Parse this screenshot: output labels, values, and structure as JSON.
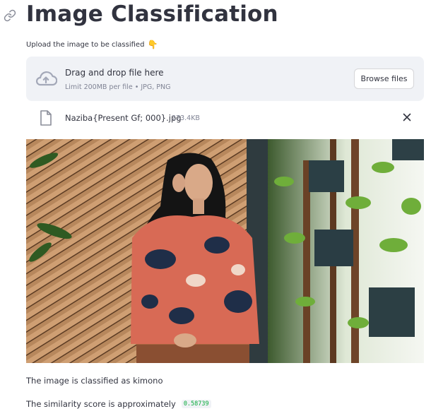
{
  "header": {
    "title": "Image Classification"
  },
  "uploader": {
    "label": "Upload the image to be classified",
    "label_icon": "pointing-down-hand-icon",
    "dropzone_title": "Drag and drop file here",
    "dropzone_subtitle": "Limit 200MB per file • JPG, PNG",
    "browse_label": "Browse files"
  },
  "file": {
    "name": "Naziba{Present Gf; 000}.jpg",
    "size": "273.4KB"
  },
  "result": {
    "classification_text": "The image is classified as kimono",
    "similarity_text": "The similarity score is approximately",
    "similarity_value": "0.58739"
  },
  "colors": {
    "accent_green": "#09ab3b",
    "dropzone_bg": "#f0f2f6",
    "text": "#31333f",
    "muted": "#808495"
  }
}
